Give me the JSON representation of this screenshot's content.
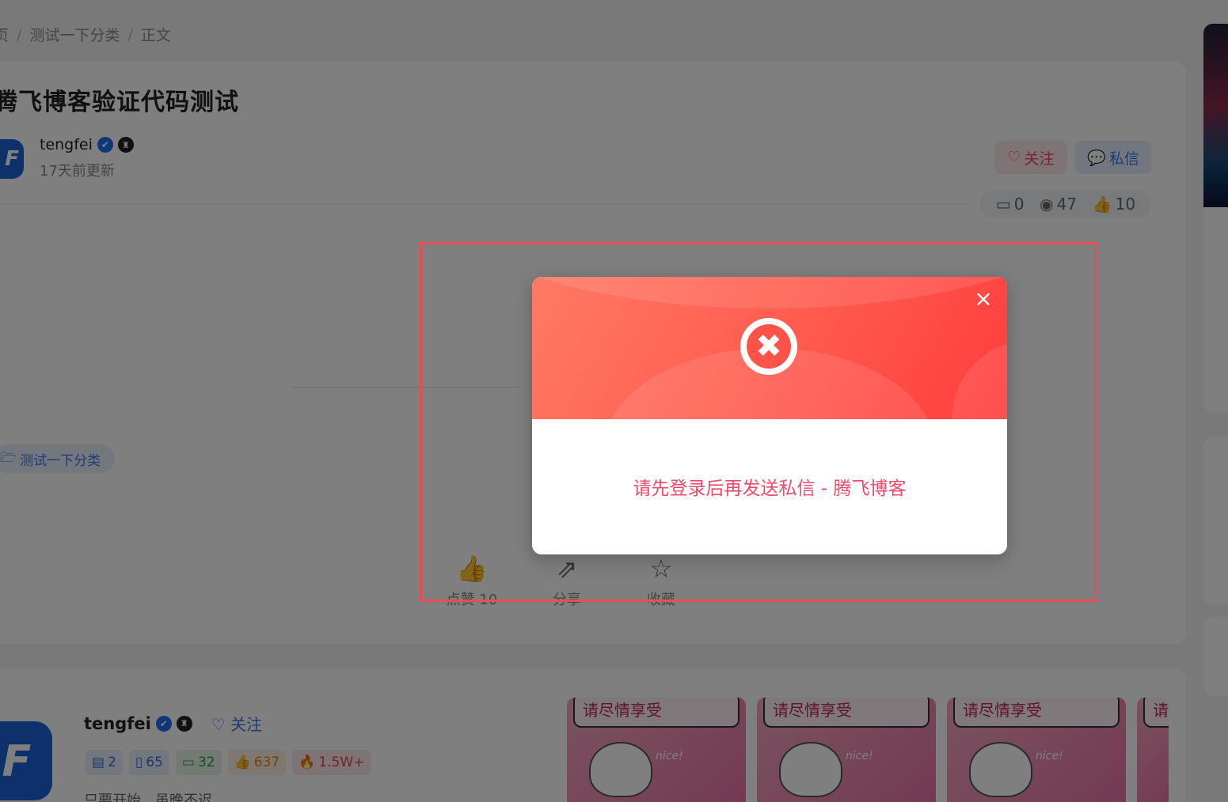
{
  "breadcrumb": {
    "home": "页",
    "category": "测试一下分类",
    "current": "正文",
    "sep": "/"
  },
  "article": {
    "title": "腾飞博客验证代码测试",
    "author": "tengfei",
    "updated": "17天前更新",
    "follow_label": "关注",
    "message_label": "私信",
    "stats": {
      "comments": "0",
      "views": "47",
      "likes": "10"
    },
    "category_tag": "测试一下分类"
  },
  "actions": {
    "like": "点赞 10",
    "share": "分享",
    "favorite": "收藏"
  },
  "author_card": {
    "name": "tengfei",
    "follow_label": "关注",
    "stats": [
      "2",
      "65",
      "32",
      "637",
      "1.5W+"
    ],
    "motto": "只要开始，虽晚不迟"
  },
  "thumbs": [
    {
      "text": "请尽情享受",
      "nice": "nice!"
    },
    {
      "text": "请尽情享受",
      "nice": "nice!"
    },
    {
      "text": "请尽情享受",
      "nice": "nice!"
    },
    {
      "text": "请尽",
      "nice": ""
    }
  ],
  "modal": {
    "message": "请先登录后再发送私信 - 腾飞博客",
    "close_glyph": "×",
    "icon_glyph": "✖"
  },
  "colors": {
    "accent_red": "#ff5a4e",
    "message_text": "#ef4a6a",
    "highlight_border": "#ef4b55"
  }
}
